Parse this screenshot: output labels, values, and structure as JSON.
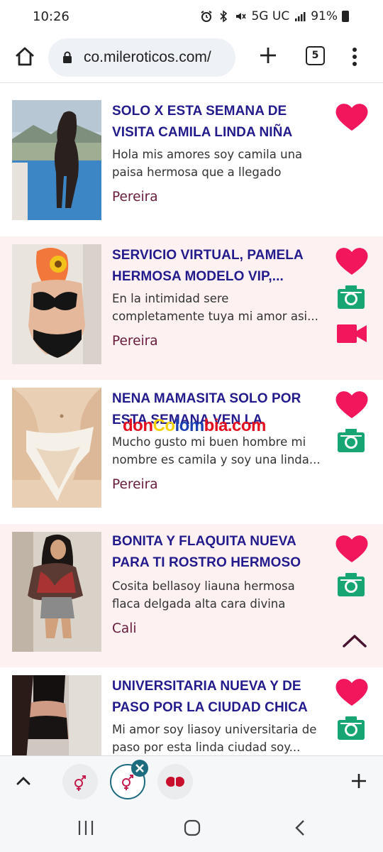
{
  "status_bar": {
    "time": "10:26",
    "network": "5G UC",
    "battery": "91%"
  },
  "browser": {
    "url": "co.mileroticos.com/",
    "tab_count": "5"
  },
  "watermark": {
    "part1": "don",
    "part2": "Co",
    "part3": "lom",
    "part4": "bia.com"
  },
  "listings": [
    {
      "title": "SOLO X ESTA SEMANA DE VISITA CAMILA LINDA NIÑA ESCORT DE...",
      "description": "Hola mis amores soy camila una paisa hermosa que a llegado para...",
      "city": "Pereira",
      "has_photo_icon": false,
      "has_video_icon": false
    },
    {
      "title": "SERVICIO VIRTUAL, PAMELA HERMOSA MODELO VIP,...",
      "description": "En la intimidad sere completamente tuya mi amor asi...",
      "city": "Pereira",
      "has_photo_icon": true,
      "has_video_icon": true
    },
    {
      "title": "NENA MAMASITA SOLO POR ESTA SEMANA VEN LA PASAREMOS...",
      "description": "Mucho gusto mi buen hombre mi nombre es camila y soy una linda...",
      "city": "Pereira",
      "has_photo_icon": true,
      "has_video_icon": false
    },
    {
      "title": "BONITA Y FLAQUITA NUEVA PARA TI ROSTRO HERMOSO",
      "description": "Cosita bellasoy liauna hermosa flaca delgada alta cara divina una...",
      "city": "Cali",
      "has_photo_icon": true,
      "has_video_icon": false
    },
    {
      "title": "UNIVERSITARIA NUEVA Y DE PASO POR LA CIUDAD CHICA SQUIRTING",
      "description": "Mi amor soy liasoy universitaria de paso por esta linda ciudad soy...",
      "city": "",
      "has_photo_icon": true,
      "has_video_icon": false
    }
  ],
  "colors": {
    "title": "#231b8c",
    "city": "#6a1b3c",
    "heart": "#f2165c",
    "camera": "#17a673",
    "video": "#f2165c",
    "alt_row": "#fdf1f1",
    "tab_accent": "#1c6b7e"
  },
  "icons": {
    "favorite": "heart-icon",
    "photos": "camera-icon",
    "video": "video-icon"
  }
}
